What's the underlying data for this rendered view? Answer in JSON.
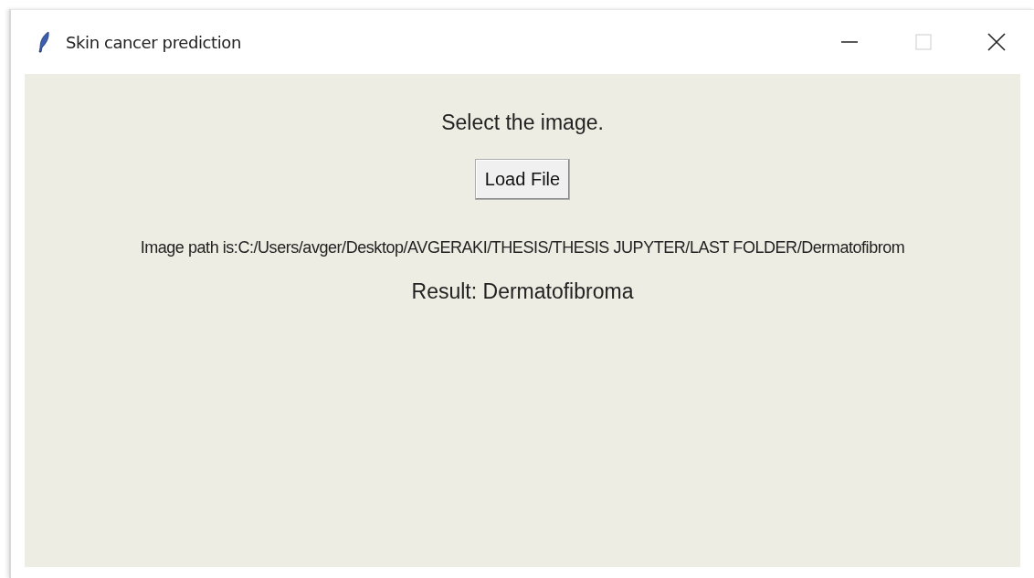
{
  "window": {
    "title": "Skin cancer prediction"
  },
  "prompt": "Select the image.",
  "load_button": "Load File",
  "image_path": "Image path is:C:/Users/avger/Desktop/AVGERAKI/THESIS/THESIS JUPYTER/LAST FOLDER/Dermatofibrom",
  "result": "Result: Dermatofibroma"
}
